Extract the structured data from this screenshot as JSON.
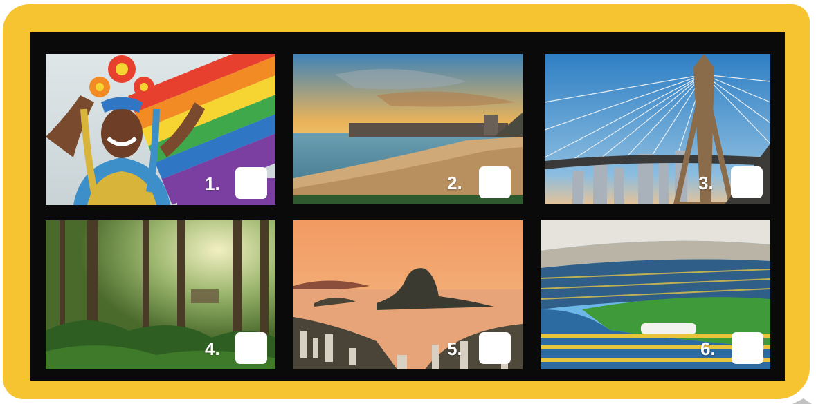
{
  "tiles": [
    {
      "number": "1.",
      "subject": "carnival dancer with rainbow flag"
    },
    {
      "number": "2.",
      "subject": "Copacabana beach at sunset"
    },
    {
      "number": "3.",
      "subject": "cable-stayed bridge and skyline"
    },
    {
      "number": "4.",
      "subject": "tropical rainforest"
    },
    {
      "number": "5.",
      "subject": "Sugarloaf Mountain bay at dusk"
    },
    {
      "number": "6.",
      "subject": "football stadium"
    }
  ],
  "colors": {
    "frame": "#f5c430",
    "board": "#0a0a0a",
    "checkbox": "#ffffff"
  }
}
